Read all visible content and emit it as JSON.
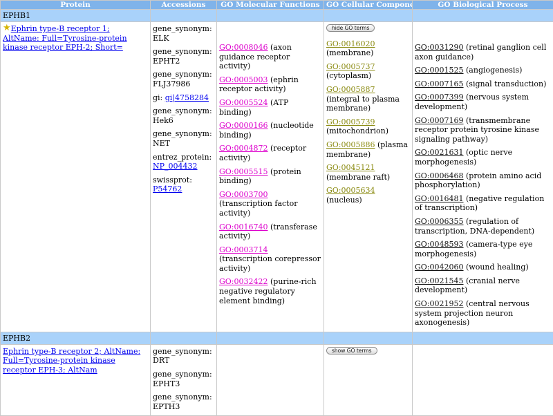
{
  "columns": [
    "Protein",
    "Accessions",
    "GO Molecular Functions",
    "GO Cellular Components",
    "GO Biological Process"
  ],
  "genes": [
    {
      "name": "EPHB1",
      "protein_link": "Ephrin type-B receptor 1; AltName: Full=Tyrosine-protein kinase receptor EPH-2; Short=",
      "star_icon": "star-icon",
      "accessions": [
        {
          "label": "gene_synonym:",
          "value": "ELK"
        },
        {
          "label": "gene_synonym:",
          "value": "EPHT2"
        },
        {
          "label": "gene_synonym:",
          "value": "FLJ37986"
        },
        {
          "label": "gi:",
          "link": "gi|4758284"
        },
        {
          "label": "gene_synonym:",
          "value": "Hek6"
        },
        {
          "label": "gene_synonym:",
          "value": "NET"
        },
        {
          "label": "entrez_protein:",
          "link": "NP_004432"
        },
        {
          "label": "swissprot:",
          "link": "P54762"
        }
      ],
      "go_button": "hide GO terms",
      "molecular_functions": [
        {
          "id": "GO:0008046",
          "desc": "(axon guidance receptor activity)"
        },
        {
          "id": "GO:0005003",
          "desc": "(ephrin receptor activity)"
        },
        {
          "id": "GO:0005524",
          "desc": "(ATP binding)"
        },
        {
          "id": "GO:0000166",
          "desc": "(nucleotide binding)"
        },
        {
          "id": "GO:0004872",
          "desc": "(receptor activity)"
        },
        {
          "id": "GO:0005515",
          "desc": "(protein binding)"
        },
        {
          "id": "GO:0003700",
          "desc": "(transcription factor activity)"
        },
        {
          "id": "GO:0016740",
          "desc": "(transferase activity)"
        },
        {
          "id": "GO:0003714",
          "desc": "(transcription corepressor activity)"
        },
        {
          "id": "GO:0032422",
          "desc": "(purine-rich negative regulatory element binding)"
        }
      ],
      "cellular_components": [
        {
          "id": "GO:0016020",
          "desc": "(membrane)"
        },
        {
          "id": "GO:0005737",
          "desc": "(cytoplasm)"
        },
        {
          "id": "GO:0005887",
          "desc": "(integral to plasma membrane)"
        },
        {
          "id": "GO:0005739",
          "desc": "(mitochondrion)"
        },
        {
          "id": "GO:0005886",
          "desc": "(plasma membrane)"
        },
        {
          "id": "GO:0045121",
          "desc": "(membrane raft)"
        },
        {
          "id": "GO:0005634",
          "desc": "(nucleus)"
        }
      ],
      "biological_processes": [
        {
          "id": "GO:0031290",
          "desc": "(retinal ganglion cell axon guidance)"
        },
        {
          "id": "GO:0001525",
          "desc": "(angiogenesis)"
        },
        {
          "id": "GO:0007165",
          "desc": "(signal transduction)"
        },
        {
          "id": "GO:0007399",
          "desc": "(nervous system development)"
        },
        {
          "id": "GO:0007169",
          "desc": "(transmembrane receptor protein tyrosine kinase signaling pathway)"
        },
        {
          "id": "GO:0021631",
          "desc": "(optic nerve morphogenesis)"
        },
        {
          "id": "GO:0006468",
          "desc": "(protein amino acid phosphorylation)"
        },
        {
          "id": "GO:0016481",
          "desc": "(negative regulation of transcription)"
        },
        {
          "id": "GO:0006355",
          "desc": "(regulation of transcription, DNA-dependent)"
        },
        {
          "id": "GO:0048593",
          "desc": "(camera-type eye morphogenesis)"
        },
        {
          "id": "GO:0042060",
          "desc": "(wound healing)"
        },
        {
          "id": "GO:0021545",
          "desc": "(cranial nerve development)"
        },
        {
          "id": "GO:0021952",
          "desc": "(central nervous system projection neuron axonogenesis)"
        }
      ]
    },
    {
      "name": "EPHB2",
      "protein_link": "Ephrin type-B receptor 2; AltName: Full=Tyrosine-protein kinase receptor EPH-3; AltNam",
      "accessions": [
        {
          "label": "gene_synonym:",
          "value": "DRT"
        },
        {
          "label": "gene_synonym:",
          "value": "EPHT3"
        },
        {
          "label": "gene_synonym:",
          "value": "EPTH3"
        }
      ],
      "go_button": "show GO terms"
    }
  ]
}
